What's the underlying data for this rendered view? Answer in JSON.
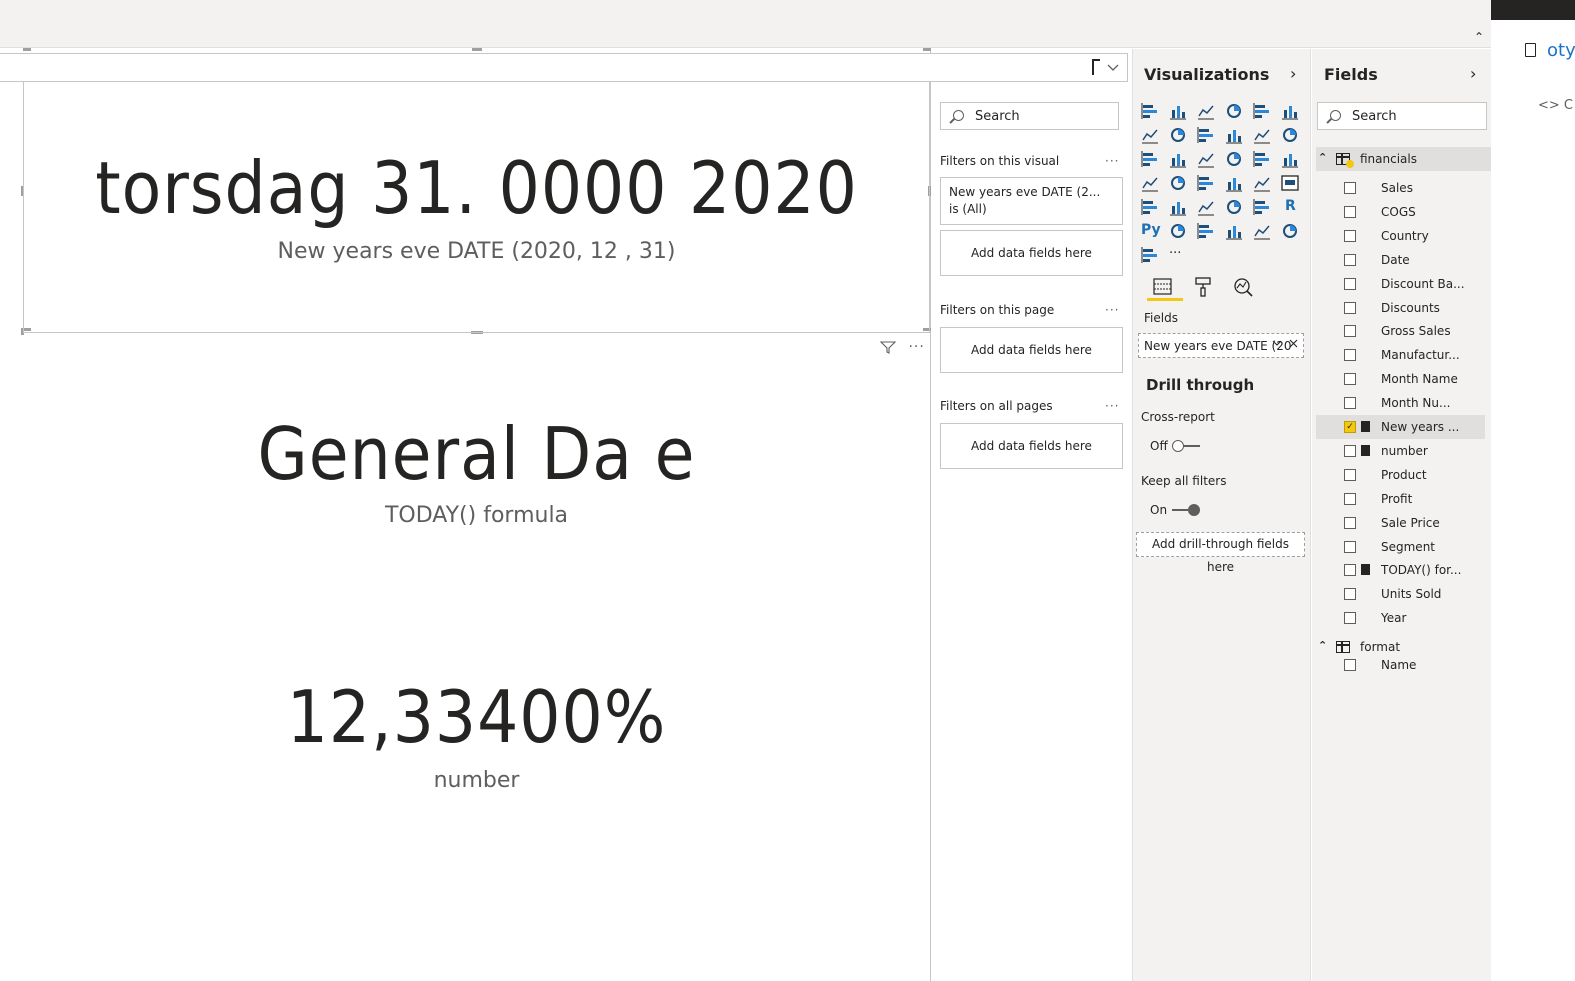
{
  "canvas": {
    "card1": {
      "value": "torsdag 31. 0000 2020",
      "label": "New years eve DATE (2020, 12 , 31)"
    },
    "card2": {
      "value": "General Da e",
      "label": "TODAY() formula"
    },
    "card3": {
      "value": "12,33400%",
      "label": "number"
    },
    "card_header": {
      "filter_icon": "filter-icon",
      "more": "···"
    }
  },
  "filters": {
    "search_placeholder": "Search",
    "on_visual_title": "Filters on this visual",
    "applied_filter_line1": "New years eve DATE (2...",
    "applied_filter_line2": "is (All)",
    "add_fields": "Add data fields here",
    "on_page_title": "Filters on this page",
    "on_all_pages_title": "Filters on all pages",
    "more": "···"
  },
  "visualizations": {
    "title": "Visualizations",
    "chevron": "›",
    "tabs": [
      "fields-tab-icon",
      "format-tab-icon",
      "analytics-tab-icon"
    ],
    "fields_label": "Fields",
    "field_well_value": "New years eve DATE (20",
    "more": "···",
    "drill_through": {
      "title": "Drill through",
      "cross_report_label": "Cross-report",
      "cross_report_state": "Off",
      "keep_filters_label": "Keep all filters",
      "keep_filters_state": "On",
      "add_fields": "Add drill-through fields here"
    },
    "py_label": "Py",
    "r_label": "R",
    "accent_color": "#f2c811"
  },
  "fields": {
    "title": "Fields",
    "chevron": "›",
    "search_placeholder": "Search",
    "tables": [
      {
        "name": "financials",
        "items": [
          {
            "name": "Sales",
            "checked": false,
            "calc": false
          },
          {
            "name": "COGS",
            "checked": false,
            "calc": false
          },
          {
            "name": "Country",
            "checked": false,
            "calc": false
          },
          {
            "name": "Date",
            "checked": false,
            "calc": false
          },
          {
            "name": "Discount Ba...",
            "checked": false,
            "calc": false
          },
          {
            "name": "Discounts",
            "checked": false,
            "calc": false
          },
          {
            "name": "Gross Sales",
            "checked": false,
            "calc": false
          },
          {
            "name": "Manufactur...",
            "checked": false,
            "calc": false
          },
          {
            "name": "Month Name",
            "checked": false,
            "calc": false
          },
          {
            "name": "Month Nu...",
            "checked": false,
            "calc": false
          },
          {
            "name": "New years ...",
            "checked": true,
            "calc": true
          },
          {
            "name": "number",
            "checked": false,
            "calc": true
          },
          {
            "name": "Product",
            "checked": false,
            "calc": false
          },
          {
            "name": "Profit",
            "checked": false,
            "calc": false
          },
          {
            "name": "Sale Price",
            "checked": false,
            "calc": false
          },
          {
            "name": "Segment",
            "checked": false,
            "calc": false
          },
          {
            "name": "TODAY() for...",
            "checked": false,
            "calc": true
          },
          {
            "name": "Units Sold",
            "checked": false,
            "calc": false
          },
          {
            "name": "Year",
            "checked": false,
            "calc": false
          }
        ]
      },
      {
        "name": "format",
        "items": [
          {
            "name": "Name",
            "checked": false,
            "calc": false
          }
        ]
      }
    ]
  },
  "side_panel": {
    "text": "oty",
    "code": "<> C"
  }
}
